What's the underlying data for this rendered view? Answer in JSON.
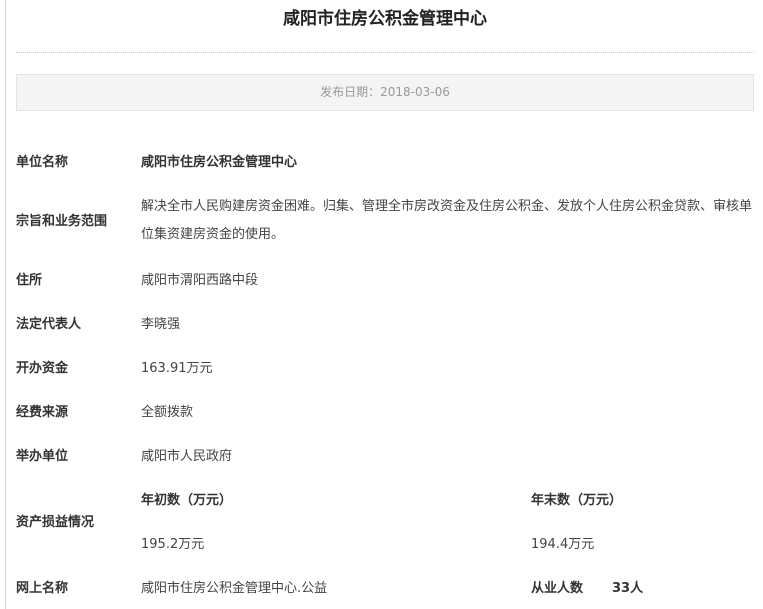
{
  "page": {
    "title": "咸阳市住房公积金管理中心",
    "publish_date": "发布日期：2018-03-06"
  },
  "fields": {
    "unit_name": {
      "label": "单位名称",
      "value": "咸阳市住房公积金管理中心"
    },
    "purpose": {
      "label": "宗旨和业务范围",
      "value": "解决全市人民购建房资金困难。归集、管理全市房改资金及住房公积金、发放个人住房公积金贷款、审核单位集资建房资金的使用。"
    },
    "address": {
      "label": "住所",
      "value": "咸阳市渭阳西路中段"
    },
    "legal_rep": {
      "label": "法定代表人",
      "value": "李晓强"
    },
    "capital": {
      "label": "开办资金",
      "value": "163.91万元"
    },
    "funding": {
      "label": "经费来源",
      "value": "全额拨款"
    },
    "sponsor": {
      "label": "举办单位",
      "value": "咸阳市人民政府"
    },
    "assets": {
      "label": "资产损益情况",
      "begin_label": "年初数（万元）",
      "begin_value": "195.2万元",
      "end_label": "年末数（万元）",
      "end_value": "194.4万元"
    },
    "web_name": {
      "label": "网上名称",
      "value": "咸阳市住房公积金管理中心.公益",
      "staff_label": "从业人数",
      "staff_value": "33人"
    }
  }
}
